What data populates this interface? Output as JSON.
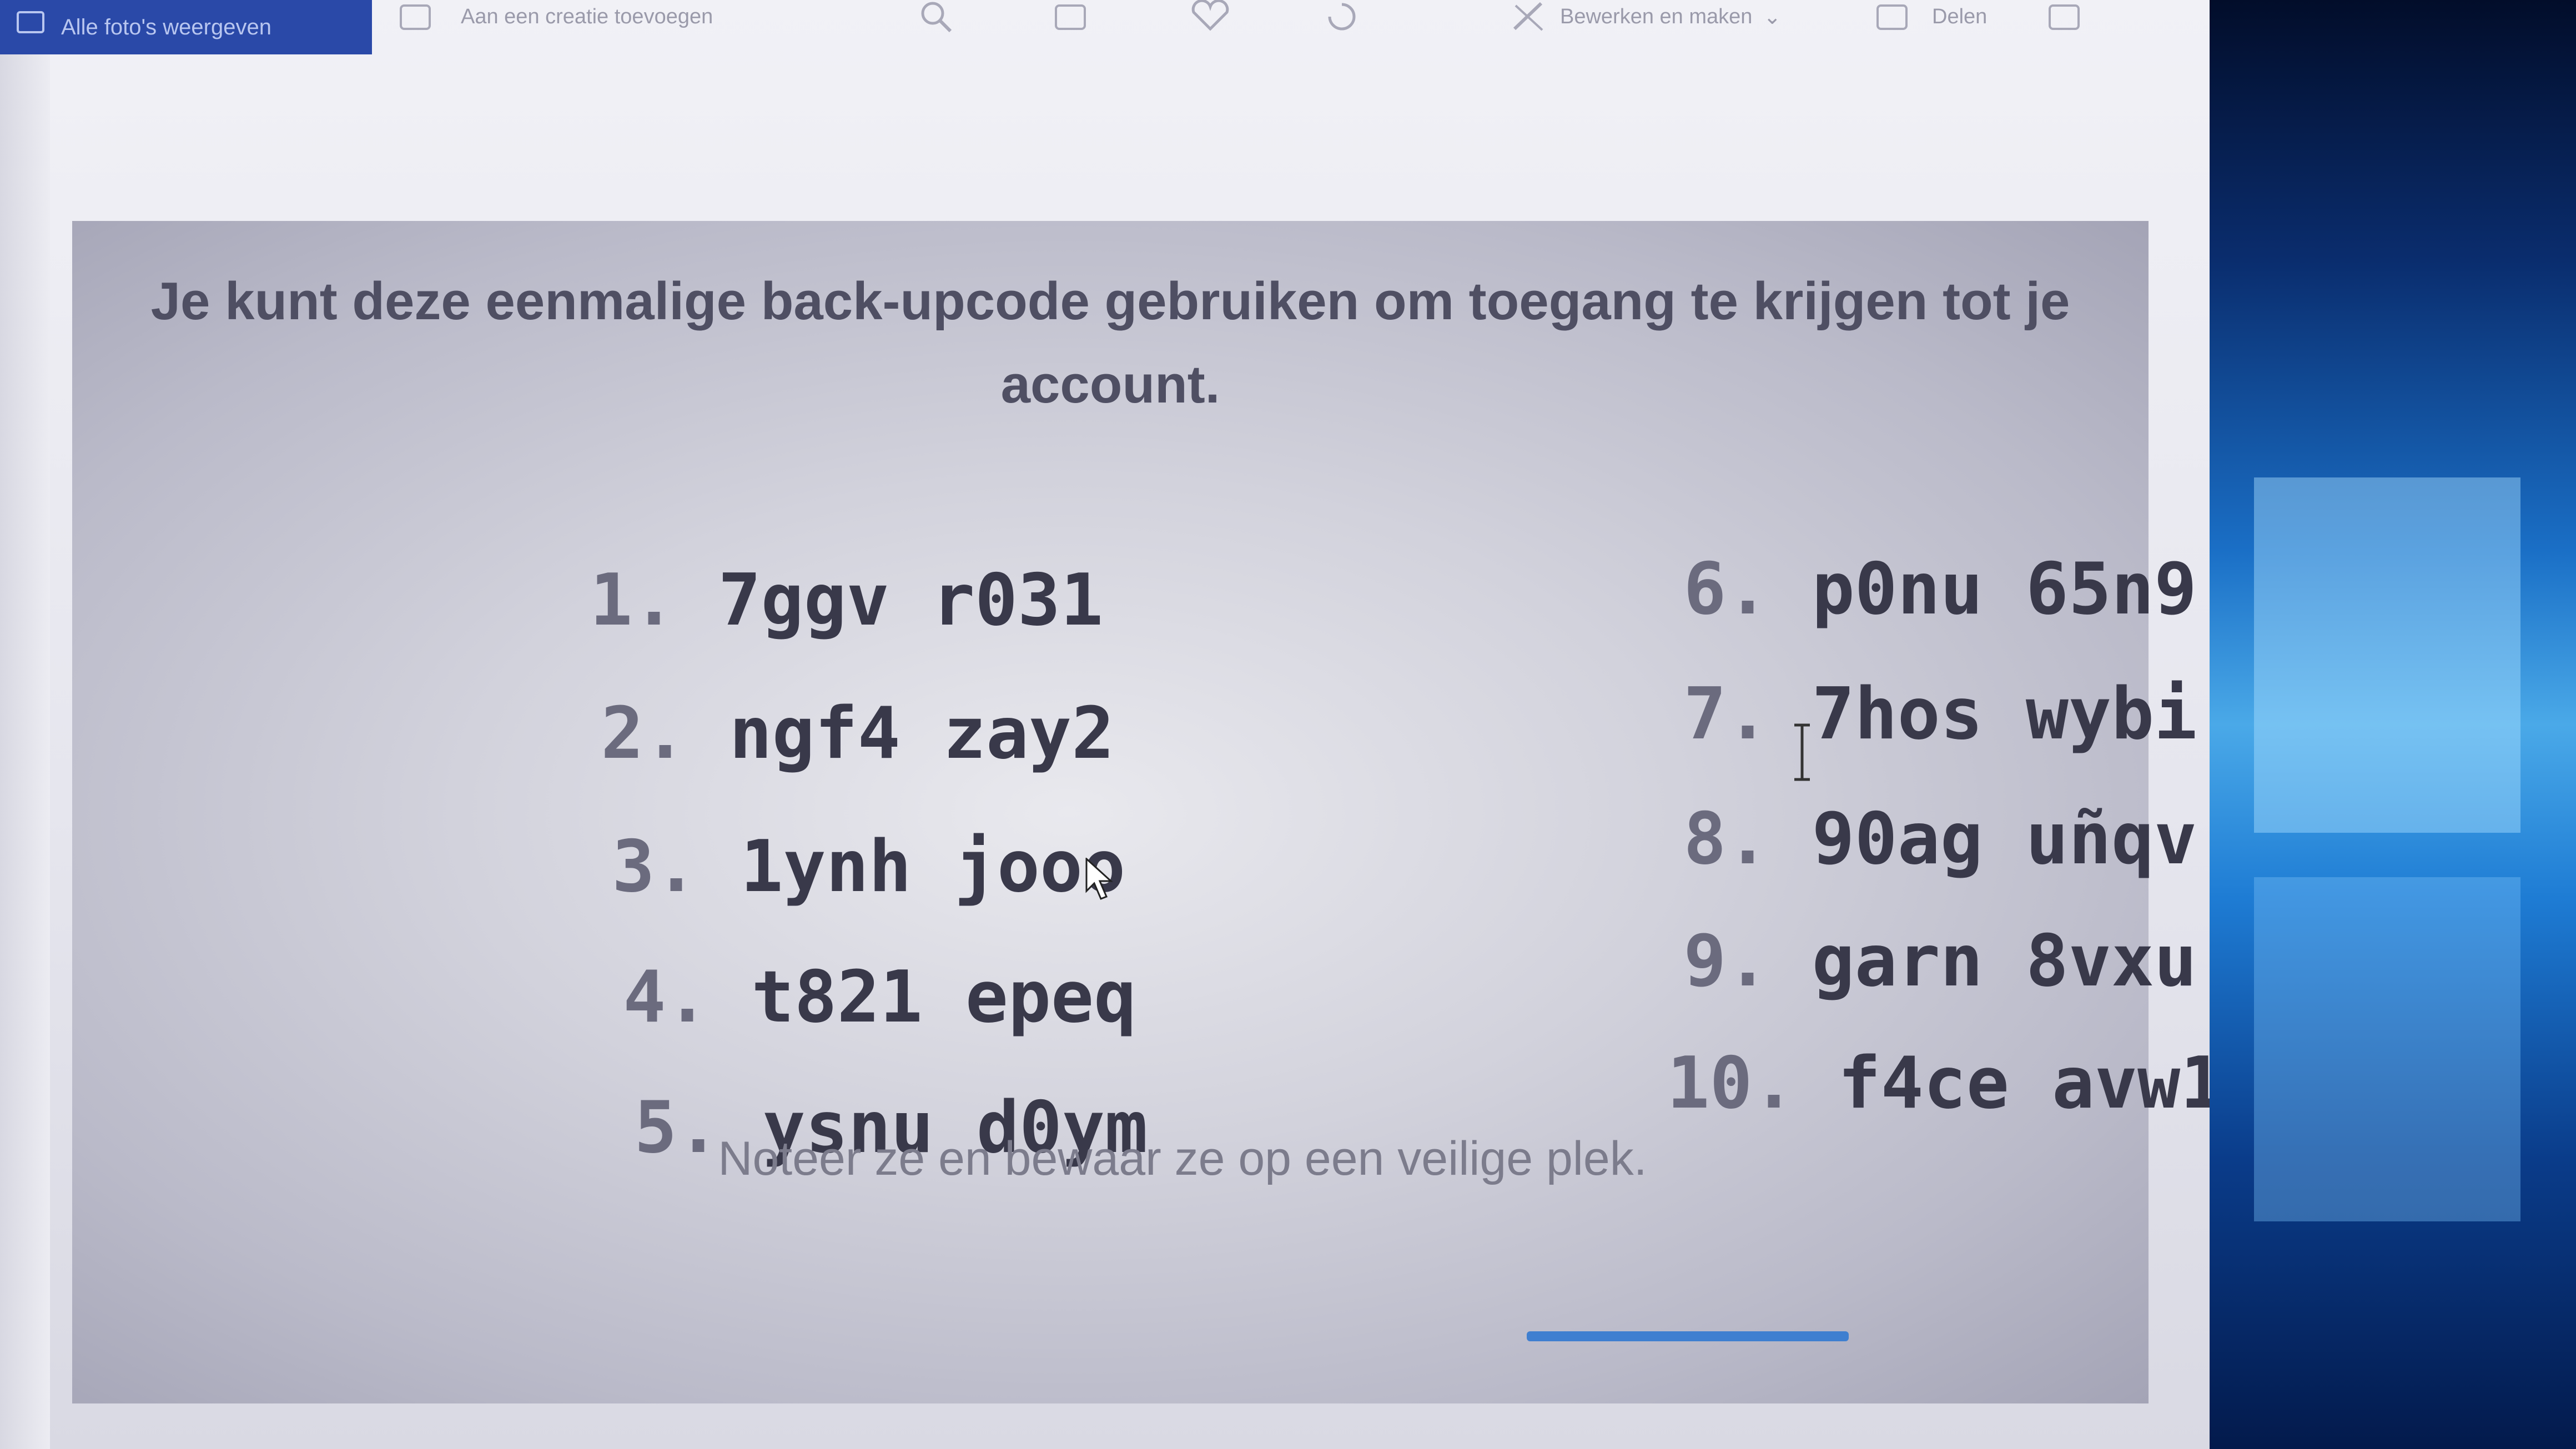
{
  "toolbar": {
    "view_all_label": "Alle foto's weergeven",
    "add_to_creation_label": "Aan een creatie toevoegen",
    "edit_label": "Bewerken en maken",
    "share_label": "Delen"
  },
  "dialog": {
    "heading": "Je kunt deze eenmalige back-upcode gebruiken om toegang te krijgen tot je account.",
    "codes_left": [
      {
        "num": "1.",
        "code": "7ggv r031"
      },
      {
        "num": "2.",
        "code": "ngf4 zay2"
      },
      {
        "num": "3.",
        "code": "1ynh jooo"
      },
      {
        "num": "4.",
        "code": "t821 epeq"
      },
      {
        "num": "5.",
        "code": "ysnu d0ym"
      }
    ],
    "codes_right": [
      {
        "num": "6.",
        "code": "p0nu 65n9"
      },
      {
        "num": "7.",
        "code": "7hos wybi"
      },
      {
        "num": "8.",
        "code": "90ag uñqv"
      },
      {
        "num": "9.",
        "code": "garn 8vxu"
      },
      {
        "num": "10.",
        "code": "f4ce avw1"
      }
    ],
    "footer_note": "Noteer ze en bewaar ze op een veilige plek."
  },
  "colors": {
    "toolbar_accent": "#2a49a8",
    "progress_accent": "#3f7fd0"
  }
}
